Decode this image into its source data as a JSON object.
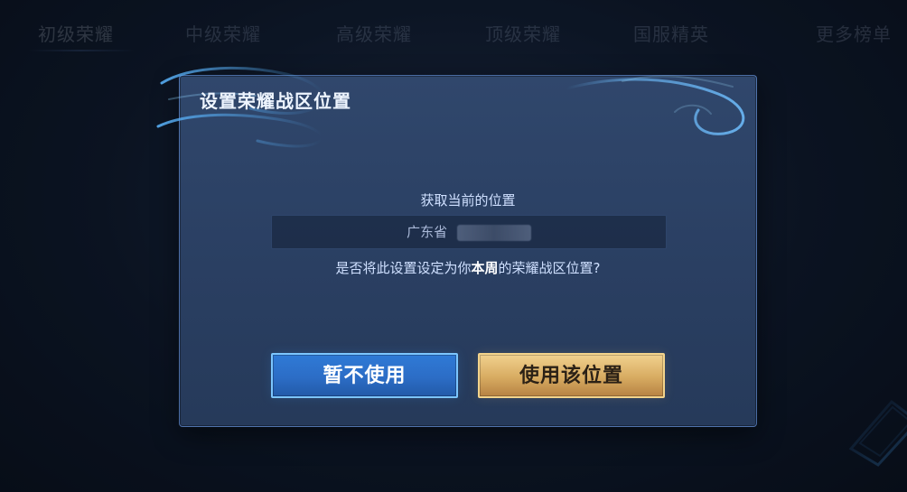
{
  "top_tabs": [
    {
      "label": "初级荣耀"
    },
    {
      "label": "中级荣耀"
    },
    {
      "label": "高级荣耀"
    },
    {
      "label": "顶级荣耀"
    },
    {
      "label": "国服精英"
    },
    {
      "label": "更多榜单"
    }
  ],
  "dialog": {
    "title": "设置荣耀战区位置",
    "subtitle": "获取当前的位置",
    "location_value": "广东省",
    "question_prefix": "是否将此设置设定为你",
    "question_emphasis": "本周",
    "question_suffix": "的荣耀战区位置?",
    "buttons": {
      "cancel": "暂不使用",
      "confirm": "使用该位置"
    }
  },
  "colors": {
    "accent_blue": "#2f7ad6",
    "accent_gold": "#d7ab61"
  },
  "icons": {
    "swirl_left": "decorative-swirl-icon",
    "swirl_right": "decorative-swirl-icon",
    "corner": "corner-decoration-icon"
  }
}
